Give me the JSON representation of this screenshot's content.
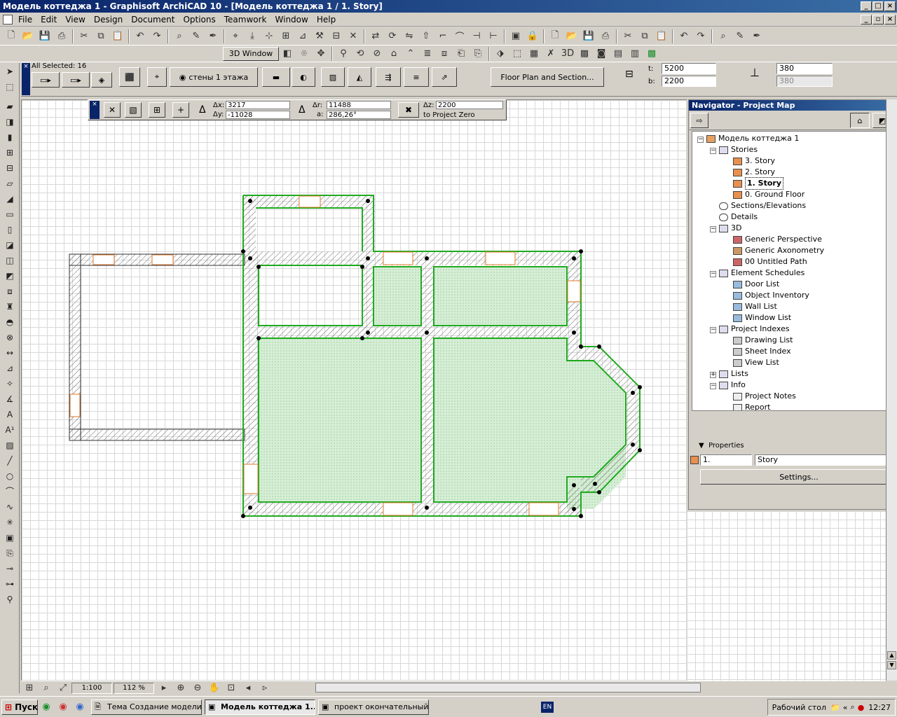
{
  "window": {
    "title": "Модель коттеджа 1 - Graphisoft ArchiCAD 10 - [Модель коттеджа 1 / 1. Story]"
  },
  "menu": {
    "items": [
      "File",
      "Edit",
      "View",
      "Design",
      "Document",
      "Options",
      "Teamwork",
      "Window",
      "Help"
    ]
  },
  "toolbar2": {
    "window3d_label": "3D Window"
  },
  "infobox": {
    "all_selected": "All Selected: 16",
    "layer_label": "стены 1 этажа",
    "floorplan_section_label": "Floor Plan and Section...",
    "t_label": "t:",
    "t_value": "5200",
    "b_label": "b:",
    "b_value": "2200",
    "height_value": "380",
    "height_value2": "380"
  },
  "coords": {
    "dx_label": "Δx:",
    "dx_value": "3217",
    "dy_label": "Δy:",
    "dy_value": "-11028",
    "dr_label": "Δr:",
    "dr_value": "11488",
    "a_label": "a:",
    "a_value": "286,26°",
    "dz_label": "Δz:",
    "dz_value": "2200",
    "to_project_zero": "to Project Zero"
  },
  "navigator": {
    "title": "Navigator - Project Map",
    "tree": {
      "root": "Модель коттеджа 1",
      "stories": "Stories",
      "story3": "3. Story",
      "story2": "2. Story",
      "story1": "1. Story",
      "story0": "0. Ground Floor",
      "sections": "Sections/Elevations",
      "details": "Details",
      "three_d": "3D",
      "generic_perspective": "Generic Perspective",
      "generic_axonometry": "Generic Axonometry",
      "untitled_path": "00 Untitled Path",
      "element_schedules": "Element Schedules",
      "door_list": "Door List",
      "object_inventory": "Object Inventory",
      "wall_list": "Wall List",
      "window_list": "Window List",
      "project_indexes": "Project Indexes",
      "drawing_list": "Drawing List",
      "sheet_index": "Sheet Index",
      "view_list": "View List",
      "lists": "Lists",
      "info": "Info",
      "project_notes": "Project Notes",
      "report": "Report"
    },
    "properties": {
      "header": "Properties",
      "id_value": "1.",
      "name_value": "Story",
      "settings_button": "Settings..."
    }
  },
  "status": {
    "scale": "1:100",
    "zoom": "112 %"
  },
  "taskbar": {
    "start": "Пуск",
    "task1": "Тема Создание модели ...",
    "task2": "Модель коттеджа 1...",
    "task3": "проект окончательный...",
    "lang": "EN",
    "desktop": "Рабочий стол",
    "time": "12:27"
  },
  "colors": {
    "wall_outline_selected": "#1faa1f",
    "zone_fill": "#d4efd4",
    "opening": "#e07a2a",
    "title_gradient_start": "#0a246a"
  }
}
